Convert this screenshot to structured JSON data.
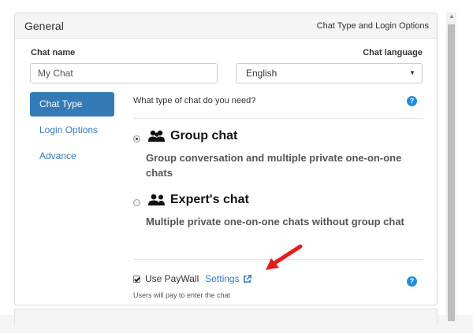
{
  "panel": {
    "title": "General",
    "header_right": "Chat Type and Login Options"
  },
  "fields": {
    "chat_name_label": "Chat name",
    "chat_name_value": "My Chat",
    "chat_language_label": "Chat language",
    "chat_language_value": "English"
  },
  "nav": {
    "items": [
      {
        "label": "Chat Type",
        "active": true
      },
      {
        "label": "Login Options",
        "active": false
      },
      {
        "label": "Advance",
        "active": false
      }
    ]
  },
  "content": {
    "question": "What type of chat do you need?",
    "help_glyph": "?",
    "options": [
      {
        "title": "Group chat",
        "description": "Group conversation and multiple private one-on-one chats",
        "selected": true,
        "icon": "users-icon"
      },
      {
        "title": "Expert's chat",
        "description": "Multiple private one-on-one chats without group chat",
        "selected": false,
        "icon": "user-pair-icon"
      }
    ],
    "paywall_label": "Use PayWall",
    "paywall_checked": true,
    "settings_link": "Settings",
    "paywall_hint": "Users will pay to enter the chat"
  },
  "colors": {
    "accent": "#337ab7",
    "link": "#3a7cc0",
    "help": "#1f8ee0",
    "arrow": "#e0201a"
  }
}
